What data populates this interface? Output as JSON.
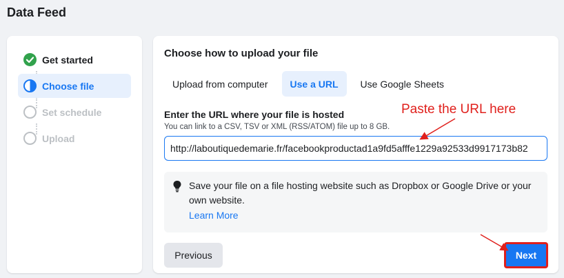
{
  "page": {
    "title": "Data Feed"
  },
  "steps": [
    {
      "label": "Get started",
      "state": "done",
      "icon": "check-icon"
    },
    {
      "label": "Choose file",
      "state": "active",
      "icon": "half-circle-icon"
    },
    {
      "label": "Set schedule",
      "state": "pending",
      "icon": "empty-circle-icon"
    },
    {
      "label": "Upload",
      "state": "pending",
      "icon": "empty-circle-icon"
    }
  ],
  "main": {
    "heading": "Choose how to upload your file",
    "tabs": [
      {
        "label": "Upload from computer",
        "selected": false
      },
      {
        "label": "Use a URL",
        "selected": true
      },
      {
        "label": "Use Google Sheets",
        "selected": false
      }
    ],
    "url_label": "Enter the URL where your file is hosted",
    "url_help": "You can link to a CSV, TSV or XML (RSS/ATOM) file up to 8 GB.",
    "url_value": "http://laboutiquedemarie.fr/facebookproductad1a9fd5afffe1229a92533d9917173b82",
    "tip_text": "Save your file on a file hosting website such as Dropbox or Google Drive or your own website.",
    "learn_more": "Learn More",
    "previous_label": "Previous",
    "next_label": "Next"
  },
  "annotation": {
    "text": "Paste the URL here",
    "color": "#e0201c"
  },
  "colors": {
    "accent": "#1877f2",
    "success": "#31a24c",
    "background": "#f0f2f5"
  }
}
